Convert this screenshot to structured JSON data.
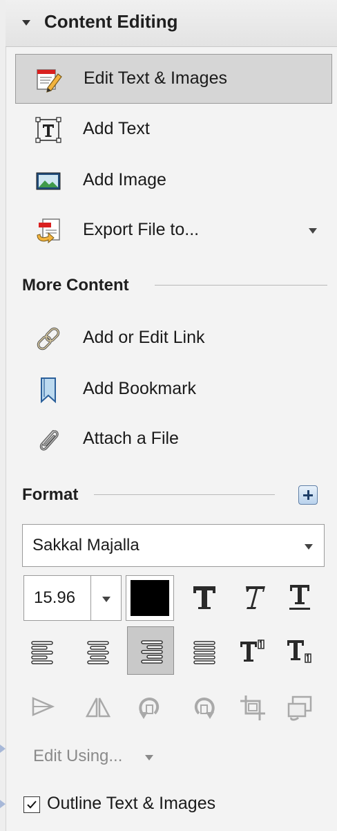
{
  "panel": {
    "title": "Content Editing",
    "tools": [
      {
        "label": "Edit Text & Images",
        "icon": "edit-text-images-icon",
        "selected": true
      },
      {
        "label": "Add Text",
        "icon": "add-text-icon",
        "selected": false
      },
      {
        "label": "Add Image",
        "icon": "add-image-icon",
        "selected": false
      },
      {
        "label": "Export File to...",
        "icon": "export-file-icon",
        "selected": false,
        "has_dropdown": true
      }
    ]
  },
  "more_content": {
    "heading": "More Content",
    "items": [
      {
        "label": "Add or Edit Link",
        "icon": "link-icon"
      },
      {
        "label": "Add Bookmark",
        "icon": "bookmark-icon"
      },
      {
        "label": "Attach a File",
        "icon": "paperclip-icon"
      }
    ]
  },
  "format": {
    "heading": "Format",
    "font_name": "Sakkal Majalla",
    "font_size": "15.96",
    "text_color": "#000000",
    "style_buttons": [
      "bold-T-icon",
      "italic-T-icon",
      "underline-T-icon"
    ],
    "align_buttons": [
      "align-left-icon",
      "align-center-icon",
      "align-right-icon",
      "align-justify-icon"
    ],
    "selected_alignment": "align-right",
    "script_buttons": [
      "superscript-icon",
      "subscript-icon"
    ],
    "arrange_buttons": [
      "flip-horizontal-icon",
      "flip-vertical-icon",
      "rotate-ccw-icon",
      "rotate-cw-icon",
      "crop-icon",
      "replace-image-icon"
    ]
  },
  "edit_using": {
    "label": "Edit Using..."
  },
  "outline": {
    "label": "Outline Text & Images",
    "checked": true
  }
}
